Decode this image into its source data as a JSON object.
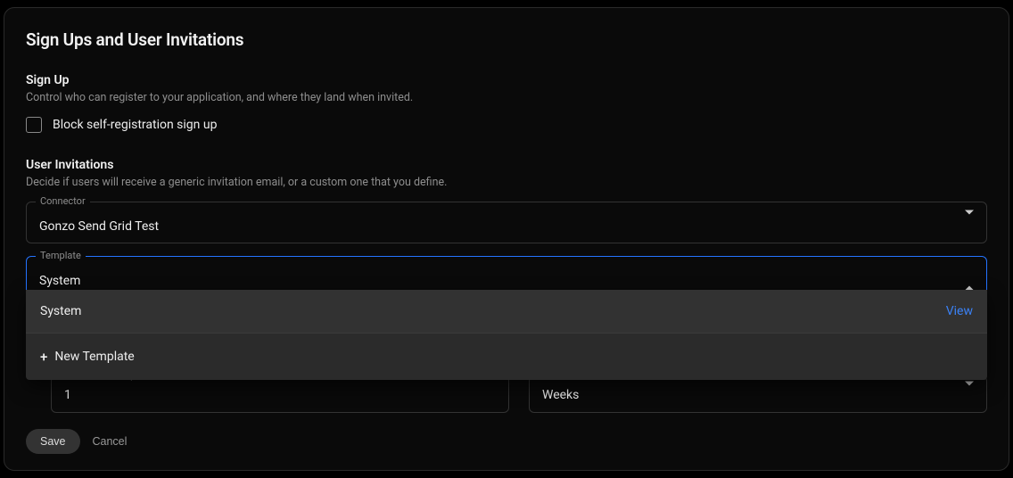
{
  "page": {
    "title": "Sign Ups and User Invitations"
  },
  "signup": {
    "heading": "Sign Up",
    "description": "Control who can register to your application, and where they land when invited.",
    "block_checkbox_label": "Block self-registration sign up",
    "block_checked": false
  },
  "invitations": {
    "heading": "User Invitations",
    "description": "Decide if users will receive a generic invitation email, or a custom one that you define.",
    "connector": {
      "label": "Connector",
      "value": "Gonzo Send Grid Test"
    },
    "template": {
      "label": "Template",
      "value": "System",
      "dropdown_open": true,
      "options": [
        {
          "label": "System",
          "action_label": "View",
          "selected": true
        }
      ],
      "new_template_label": "New Template"
    },
    "expiration": {
      "label": "Invite Token Expiration",
      "value": "1",
      "unit": "Weeks"
    }
  },
  "footer": {
    "save": "Save",
    "cancel": "Cancel"
  }
}
